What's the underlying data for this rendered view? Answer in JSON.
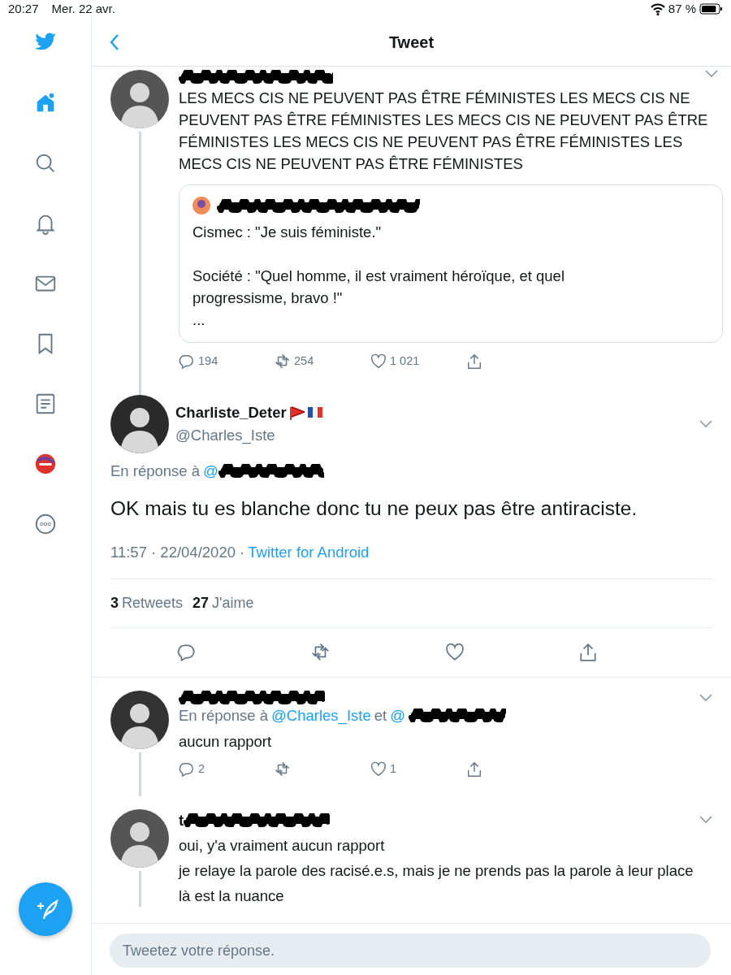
{
  "status_bar": {
    "time": "20:27",
    "date": "Mer. 22 avr.",
    "battery": "87 %"
  },
  "sidebar": {
    "items": [
      {
        "kind": "home",
        "selected": true
      },
      {
        "kind": "search",
        "selected": false
      },
      {
        "kind": "bell",
        "selected": false
      },
      {
        "kind": "mail",
        "selected": false
      },
      {
        "kind": "bookmark",
        "selected": false
      },
      {
        "kind": "list",
        "selected": false
      },
      {
        "kind": "profile",
        "selected": false
      },
      {
        "kind": "more",
        "selected": false
      }
    ]
  },
  "header": {
    "title": "Tweet"
  },
  "parent_tweet": {
    "text": "LES MECS CIS NE PEUVENT PAS ÊTRE FÉMINISTES LES MECS CIS NE PEUVENT PAS ÊTRE FÉMINISTES LES MECS CIS NE PEUVENT PAS ÊTRE FÉMINISTES LES MECS CIS NE PEUVENT PAS ÊTRE FÉMINISTES LES MECS CIS NE PEUVENT PAS ÊTRE FÉMINISTES",
    "quote": {
      "paragraphs": [
        "Cismec : \"Je suis féministe.\"",
        "Société : \"Quel homme, il est vraiment héroïque, et quel progressisme, bravo !\"",
        "..."
      ]
    },
    "counts": {
      "replies": "194",
      "retweets": "254",
      "likes": "1 021"
    }
  },
  "main_tweet": {
    "name": "Charliste_Deter",
    "handle": "@Charles_Iste",
    "reply_prefix": "En réponse à",
    "reply_mention": "@",
    "text": "OK mais tu es blanche donc tu ne peux pas être antiraciste.",
    "timestamp": "11:57 · 22/04/2020 ·",
    "source": "Twitter for Android",
    "retweets": "3",
    "retweets_label": "Retweets",
    "likes": "27",
    "likes_label": "J'aime"
  },
  "replies": [
    {
      "reply_prefix": "En réponse à",
      "mention": "@Charles_Iste",
      "joiner": "et",
      "mention_2": "@",
      "lines": [
        "aucun rapport"
      ],
      "counts": {
        "replies": "2",
        "likes": "1"
      }
    },
    {
      "name_start": "t",
      "lines": [
        "oui, y'a vraiment aucun rapport",
        "je relaye la parole des racisé.e.s, mais je ne prends pas la parole à leur place",
        "là est la nuance"
      ]
    }
  ],
  "compose": {
    "placeholder": "Tweetez votre réponse."
  }
}
